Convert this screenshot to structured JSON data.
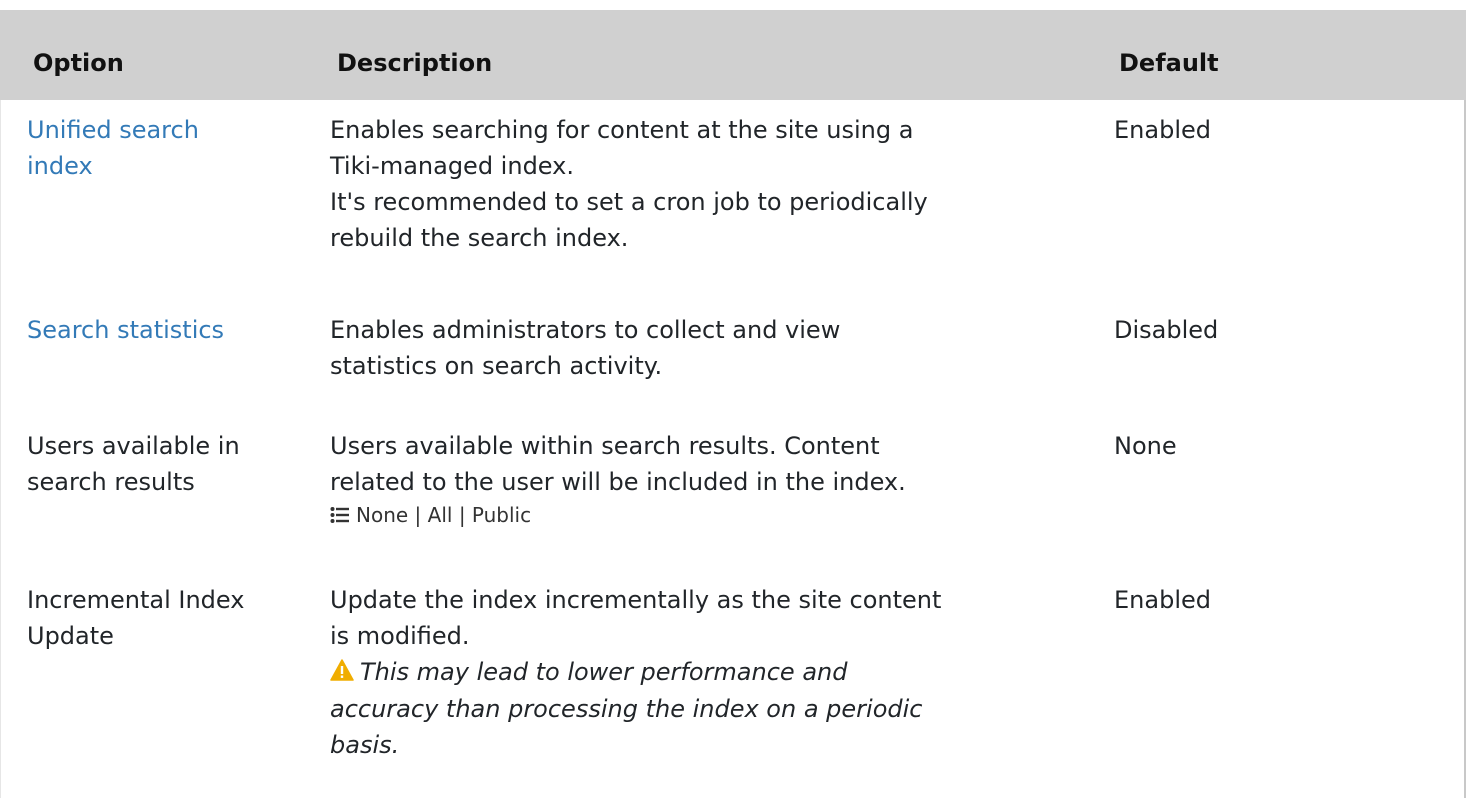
{
  "columns": {
    "option": "Option",
    "description": "Description",
    "default": "Default"
  },
  "rows": [
    {
      "option": "Unified search index",
      "option_lines": [
        "Unified search",
        "index"
      ],
      "option_is_link": true,
      "description_lines": [
        "Enables searching for content at the site using a",
        "Tiki-managed index.",
        "It's recommended to set a cron job to periodically",
        "rebuild the search index."
      ],
      "default": "Enabled"
    },
    {
      "option": "Search statistics",
      "option_lines": [
        "Search statistics"
      ],
      "option_is_link": true,
      "description_lines": [
        "Enables administrators to collect and view",
        "statistics on search activity."
      ],
      "default": "Disabled"
    },
    {
      "option": "Users available in search results",
      "option_lines": [
        "Users available in",
        "search results"
      ],
      "option_is_link": false,
      "description_lines": [
        "Users available within search results. Content",
        "related to the user will be included in the index."
      ],
      "options_list": {
        "icon": "list-icon",
        "items": [
          "None",
          "All",
          "Public"
        ],
        "separator": "|"
      },
      "default": "None"
    },
    {
      "option": "Incremental Index Update",
      "option_lines": [
        "Incremental Index",
        "Update"
      ],
      "option_is_link": false,
      "description_lines": [
        "Update the index incrementally as the site content",
        "is modified."
      ],
      "warning": {
        "icon": "warning-icon",
        "icon_color": "#f0ad00",
        "lines": [
          "This may lead to lower performance and",
          "accuracy than processing the index on a periodic",
          "basis."
        ]
      },
      "default": "Enabled"
    }
  ],
  "colors": {
    "header_bg": "#d0d0d0",
    "link": "#337ab7",
    "text": "#212529"
  }
}
